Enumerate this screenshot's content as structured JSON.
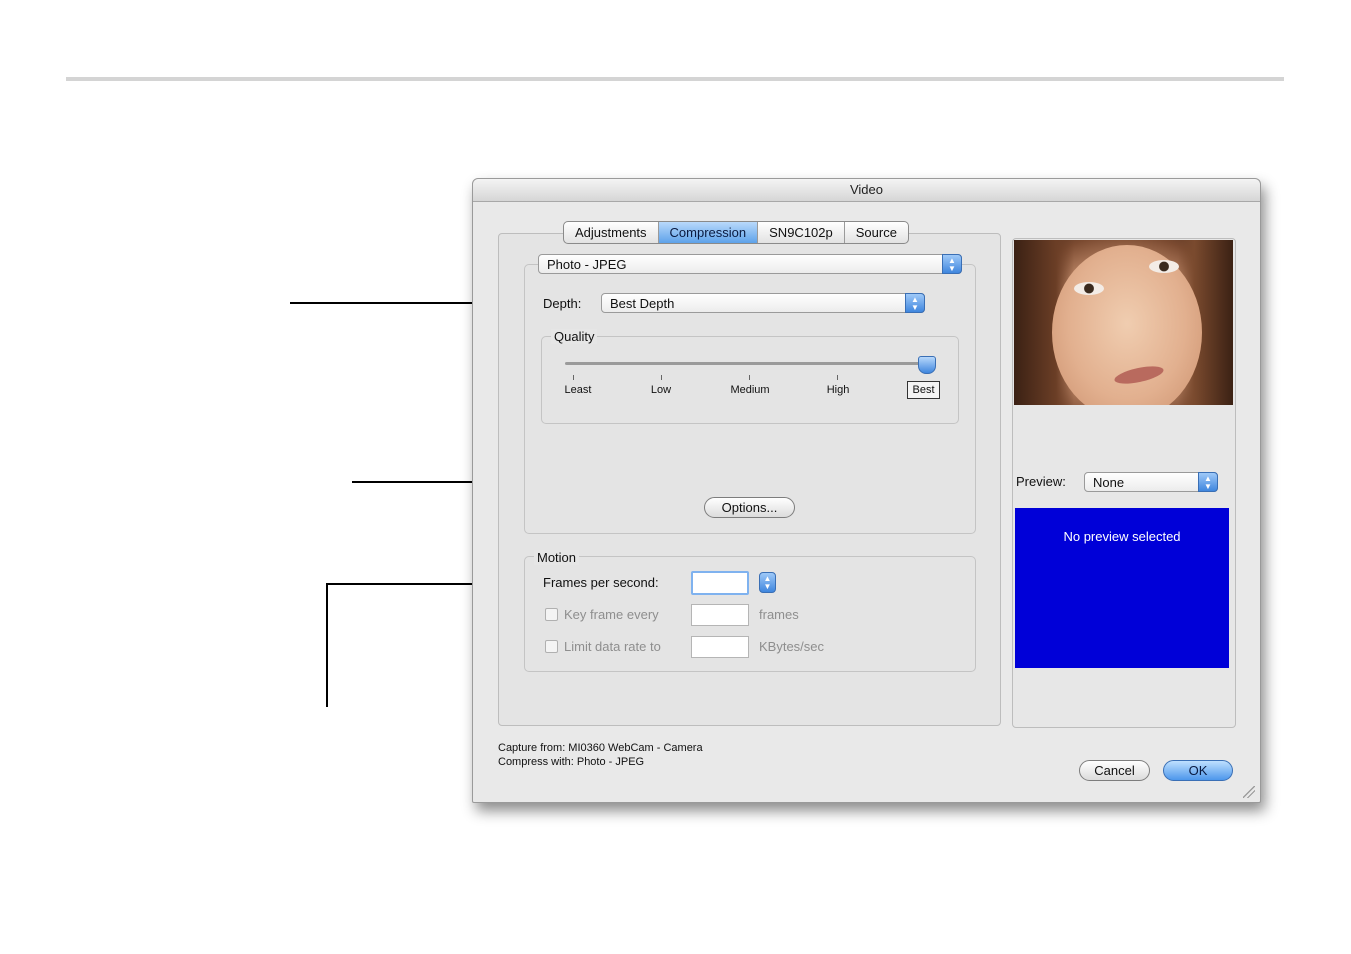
{
  "window": {
    "title": "Video"
  },
  "tabs": [
    "Adjustments",
    "Compression",
    "SN9C102p",
    "Source"
  ],
  "selected_tab": "Compression",
  "compression": {
    "codec": "Photo - JPEG",
    "depth_label": "Depth:",
    "depth_value": "Best Depth",
    "quality_label": "Quality",
    "quality_ticks": [
      "Least",
      "Low",
      "Medium",
      "High",
      "Best"
    ],
    "quality_selected": "Best",
    "options_button": "Options..."
  },
  "motion": {
    "label": "Motion",
    "fps_label": "Frames per second:",
    "fps_value": "",
    "keyframe_label": "Key frame every",
    "keyframe_unit": "frames",
    "limit_label": "Limit data rate to",
    "limit_unit": "KBytes/sec"
  },
  "preview": {
    "label": "Preview:",
    "value": "None",
    "message": "No preview selected"
  },
  "info": {
    "capture": "Capture from: MI0360 WebCam - Camera",
    "compress": "Compress with: Photo - JPEG"
  },
  "buttons": {
    "cancel": "Cancel",
    "ok": "OK"
  },
  "colors": {
    "preview_bg": "#0000d8",
    "accent": "#4d97ec"
  }
}
